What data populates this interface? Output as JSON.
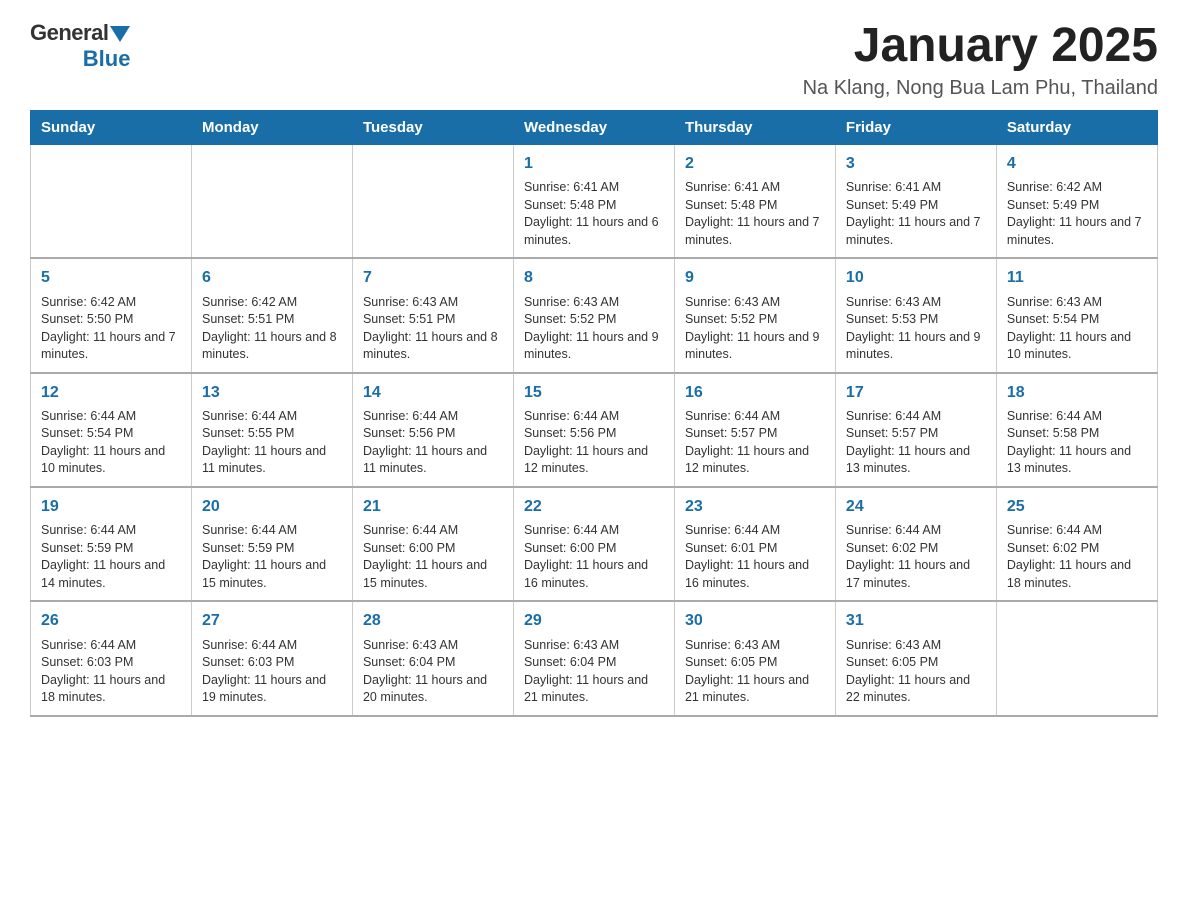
{
  "logo": {
    "text_general": "General",
    "text_blue": "Blue"
  },
  "title": "January 2025",
  "subtitle": "Na Klang, Nong Bua Lam Phu, Thailand",
  "days_of_week": [
    "Sunday",
    "Monday",
    "Tuesday",
    "Wednesday",
    "Thursday",
    "Friday",
    "Saturday"
  ],
  "weeks": [
    [
      {
        "day": "",
        "info": ""
      },
      {
        "day": "",
        "info": ""
      },
      {
        "day": "",
        "info": ""
      },
      {
        "day": "1",
        "info": "Sunrise: 6:41 AM\nSunset: 5:48 PM\nDaylight: 11 hours and 6 minutes."
      },
      {
        "day": "2",
        "info": "Sunrise: 6:41 AM\nSunset: 5:48 PM\nDaylight: 11 hours and 7 minutes."
      },
      {
        "day": "3",
        "info": "Sunrise: 6:41 AM\nSunset: 5:49 PM\nDaylight: 11 hours and 7 minutes."
      },
      {
        "day": "4",
        "info": "Sunrise: 6:42 AM\nSunset: 5:49 PM\nDaylight: 11 hours and 7 minutes."
      }
    ],
    [
      {
        "day": "5",
        "info": "Sunrise: 6:42 AM\nSunset: 5:50 PM\nDaylight: 11 hours and 7 minutes."
      },
      {
        "day": "6",
        "info": "Sunrise: 6:42 AM\nSunset: 5:51 PM\nDaylight: 11 hours and 8 minutes."
      },
      {
        "day": "7",
        "info": "Sunrise: 6:43 AM\nSunset: 5:51 PM\nDaylight: 11 hours and 8 minutes."
      },
      {
        "day": "8",
        "info": "Sunrise: 6:43 AM\nSunset: 5:52 PM\nDaylight: 11 hours and 9 minutes."
      },
      {
        "day": "9",
        "info": "Sunrise: 6:43 AM\nSunset: 5:52 PM\nDaylight: 11 hours and 9 minutes."
      },
      {
        "day": "10",
        "info": "Sunrise: 6:43 AM\nSunset: 5:53 PM\nDaylight: 11 hours and 9 minutes."
      },
      {
        "day": "11",
        "info": "Sunrise: 6:43 AM\nSunset: 5:54 PM\nDaylight: 11 hours and 10 minutes."
      }
    ],
    [
      {
        "day": "12",
        "info": "Sunrise: 6:44 AM\nSunset: 5:54 PM\nDaylight: 11 hours and 10 minutes."
      },
      {
        "day": "13",
        "info": "Sunrise: 6:44 AM\nSunset: 5:55 PM\nDaylight: 11 hours and 11 minutes."
      },
      {
        "day": "14",
        "info": "Sunrise: 6:44 AM\nSunset: 5:56 PM\nDaylight: 11 hours and 11 minutes."
      },
      {
        "day": "15",
        "info": "Sunrise: 6:44 AM\nSunset: 5:56 PM\nDaylight: 11 hours and 12 minutes."
      },
      {
        "day": "16",
        "info": "Sunrise: 6:44 AM\nSunset: 5:57 PM\nDaylight: 11 hours and 12 minutes."
      },
      {
        "day": "17",
        "info": "Sunrise: 6:44 AM\nSunset: 5:57 PM\nDaylight: 11 hours and 13 minutes."
      },
      {
        "day": "18",
        "info": "Sunrise: 6:44 AM\nSunset: 5:58 PM\nDaylight: 11 hours and 13 minutes."
      }
    ],
    [
      {
        "day": "19",
        "info": "Sunrise: 6:44 AM\nSunset: 5:59 PM\nDaylight: 11 hours and 14 minutes."
      },
      {
        "day": "20",
        "info": "Sunrise: 6:44 AM\nSunset: 5:59 PM\nDaylight: 11 hours and 15 minutes."
      },
      {
        "day": "21",
        "info": "Sunrise: 6:44 AM\nSunset: 6:00 PM\nDaylight: 11 hours and 15 minutes."
      },
      {
        "day": "22",
        "info": "Sunrise: 6:44 AM\nSunset: 6:00 PM\nDaylight: 11 hours and 16 minutes."
      },
      {
        "day": "23",
        "info": "Sunrise: 6:44 AM\nSunset: 6:01 PM\nDaylight: 11 hours and 16 minutes."
      },
      {
        "day": "24",
        "info": "Sunrise: 6:44 AM\nSunset: 6:02 PM\nDaylight: 11 hours and 17 minutes."
      },
      {
        "day": "25",
        "info": "Sunrise: 6:44 AM\nSunset: 6:02 PM\nDaylight: 11 hours and 18 minutes."
      }
    ],
    [
      {
        "day": "26",
        "info": "Sunrise: 6:44 AM\nSunset: 6:03 PM\nDaylight: 11 hours and 18 minutes."
      },
      {
        "day": "27",
        "info": "Sunrise: 6:44 AM\nSunset: 6:03 PM\nDaylight: 11 hours and 19 minutes."
      },
      {
        "day": "28",
        "info": "Sunrise: 6:43 AM\nSunset: 6:04 PM\nDaylight: 11 hours and 20 minutes."
      },
      {
        "day": "29",
        "info": "Sunrise: 6:43 AM\nSunset: 6:04 PM\nDaylight: 11 hours and 21 minutes."
      },
      {
        "day": "30",
        "info": "Sunrise: 6:43 AM\nSunset: 6:05 PM\nDaylight: 11 hours and 21 minutes."
      },
      {
        "day": "31",
        "info": "Sunrise: 6:43 AM\nSunset: 6:05 PM\nDaylight: 11 hours and 22 minutes."
      },
      {
        "day": "",
        "info": ""
      }
    ]
  ]
}
